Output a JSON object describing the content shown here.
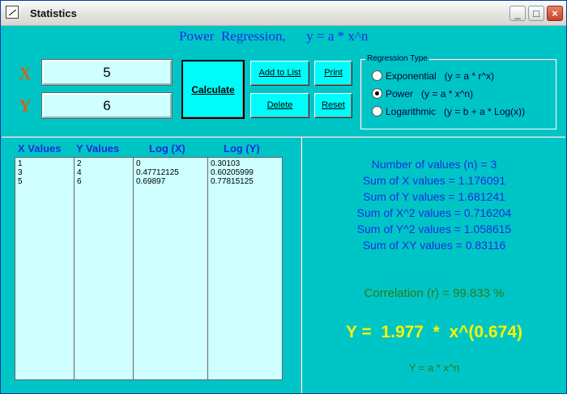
{
  "window": {
    "title": "Statistics",
    "minimize_label": "_",
    "maximize_label": "□",
    "close_label": "×"
  },
  "heading": "Power  Regression,      y = a * x^n",
  "inputs": {
    "x_label": "X",
    "x_value": "5",
    "y_label": "Y",
    "y_value": "6"
  },
  "buttons": {
    "calculate": "Calculate",
    "add_to_list": "Add to List",
    "print": "Print",
    "delete": "Delete",
    "reset": "Reset"
  },
  "regression_type": {
    "title": "Regression Type",
    "options": [
      {
        "label": "Exponential   (y = a * r^x)",
        "selected": false
      },
      {
        "label": "Power   (y = a * x^n)",
        "selected": true
      },
      {
        "label": "Logarithmic   (y = b + a * Log(x))",
        "selected": false
      }
    ]
  },
  "table": {
    "headers": [
      "X Values",
      "Y Values",
      "Log (X)",
      "Log (Y)"
    ],
    "columns": [
      [
        "1",
        "3",
        "5"
      ],
      [
        "2",
        "4",
        "6"
      ],
      [
        "0",
        "0.47712125",
        "0.69897"
      ],
      [
        "0.30103",
        "0.60205999",
        "0.77815125"
      ]
    ]
  },
  "stats": [
    "Number of values (n) = 3",
    "Sum of X values = 1.176091",
    "Sum of Y values = 1.681241",
    "Sum of X^2 values = 0.716204",
    "Sum of Y^2 values = 1.058615",
    "Sum of XY values = 0.83116"
  ],
  "correlation": "Correlation (r) = 99.833 %",
  "result": "Y =  1.977  *  x^(0.674)",
  "formula": "Y = a * x^n",
  "colors": {
    "background": "#00c5c6",
    "heading_blue": "#1a2ee0",
    "result_yellow": "#f6f600",
    "label_orange": "#c46a1a",
    "green": "#2a7a1a"
  }
}
